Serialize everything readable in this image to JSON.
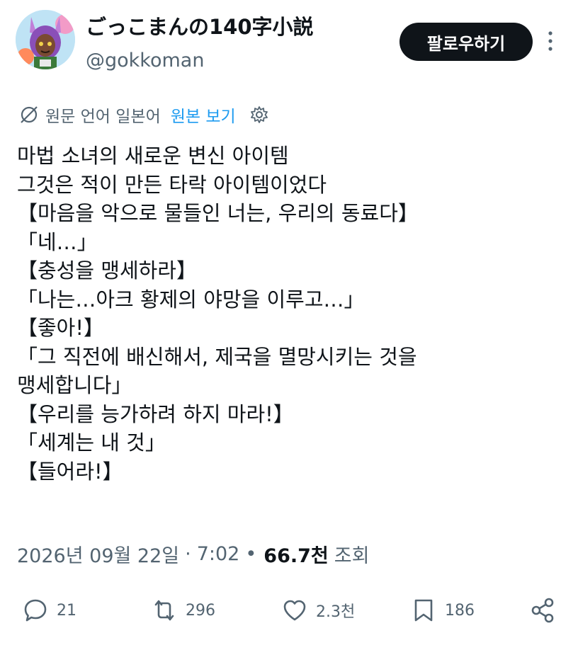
{
  "author": {
    "display_name": "ごっこまんの140字小説",
    "handle": "@gokkoman"
  },
  "follow_button": {
    "label": "팔로우하기"
  },
  "translation": {
    "source_language_label": "원문 언어 일본어",
    "view_original_label": "원본 보기"
  },
  "tweet": {
    "lines": [
      "마법 소녀의 새로운 변신 아이템",
      "그것은 적이 만든 타락 아이템이었다",
      "【마음을 악으로 물들인 너는, 우리의 동료다】",
      "「네…」",
      "【충성을 맹세하라】",
      "「나는…아크 황제의 야망을 이루고…」",
      "【좋아!】",
      "「그 직전에 배신해서, 제국을 멸망시키는 것을",
      "맹세합니다」",
      "【우리를 능가하려 하지 마라!】",
      "「세계는 내 것」",
      "【들어라!】"
    ]
  },
  "meta": {
    "date": "2026년 09월 22일",
    "separator": "·",
    "time": "7:02",
    "bullet": "•",
    "views": "66.7천",
    "views_label": "조회"
  },
  "actions": {
    "replies": "21",
    "reposts": "296",
    "likes": "2.3천",
    "bookmarks": "186"
  },
  "icons": {
    "reply": "speech-bubble",
    "repost": "retweet-arrows",
    "like": "heart-outline",
    "bookmark": "bookmark-outline",
    "share": "share-nodes",
    "more": "vertical-ellipsis",
    "translate": "slashed-circle",
    "settings": "gear"
  },
  "colors": {
    "follow_bg": "#0f1419",
    "link": "#1d9bf0",
    "secondary_text": "#536471"
  }
}
